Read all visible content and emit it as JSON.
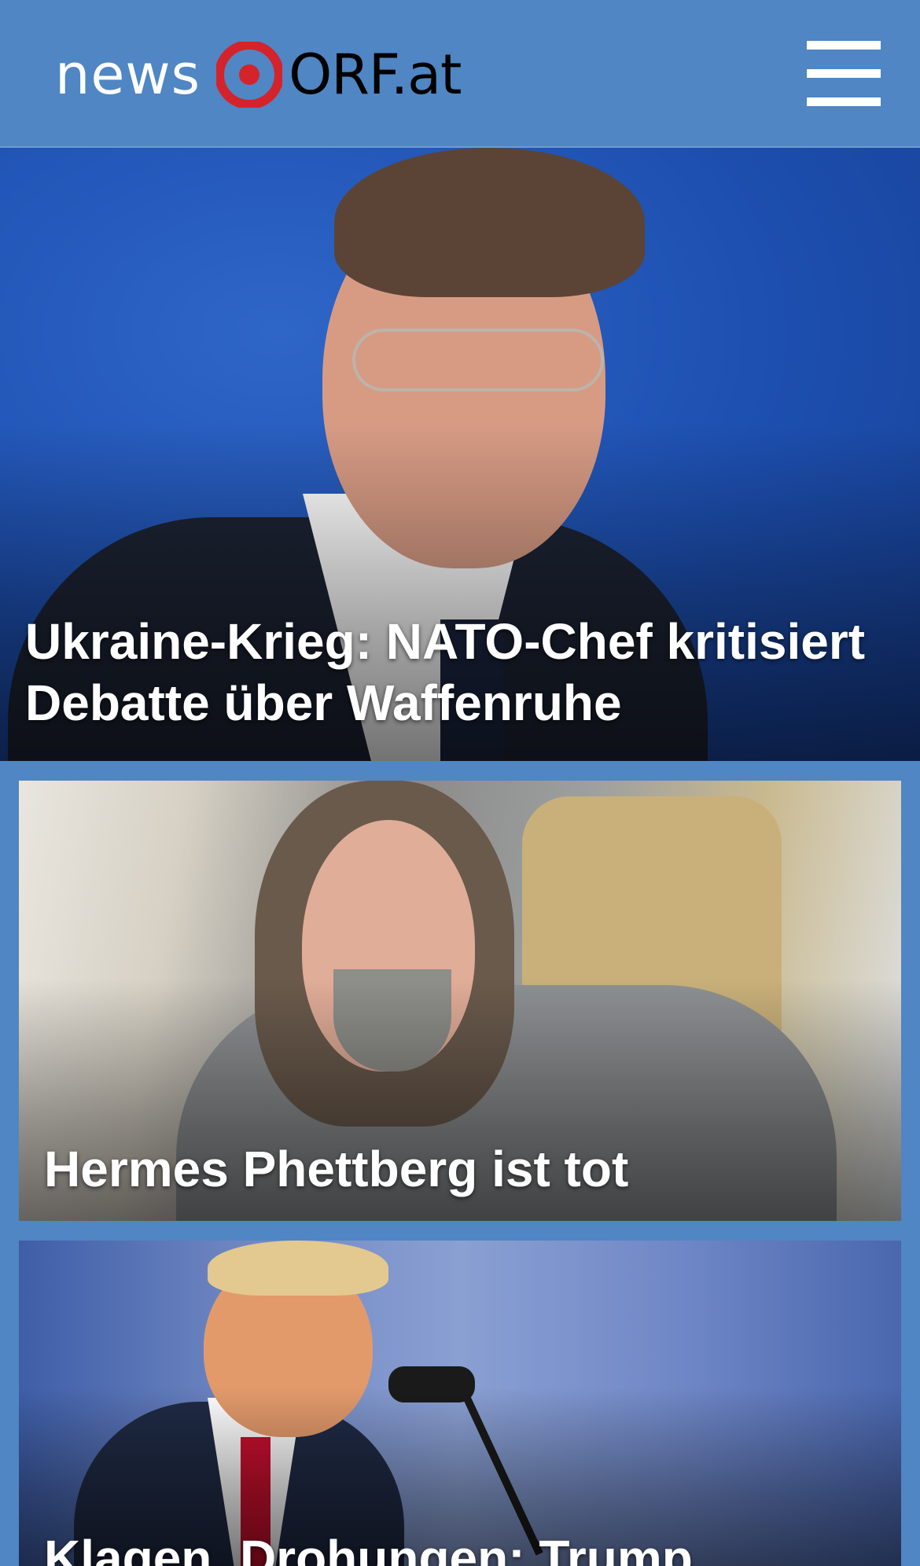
{
  "header": {
    "logo_prefix": "news",
    "logo_brand": "ORF.at",
    "logo_icon": "orf-target-icon",
    "menu_icon": "hamburger-menu-icon"
  },
  "colors": {
    "header_bg": "#4f86c3",
    "logo_red": "#d4232b",
    "headline_text": "#ffffff"
  },
  "stories": [
    {
      "headline_line1": "Ukraine-Krieg: NATO-Chef kritisiert",
      "headline_line2": "Debatte über Waffenruhe"
    },
    {
      "headline_line1": "Hermes Phettberg ist tot"
    },
    {
      "headline_line1": "Klagen, Drohungen: Trump"
    }
  ]
}
